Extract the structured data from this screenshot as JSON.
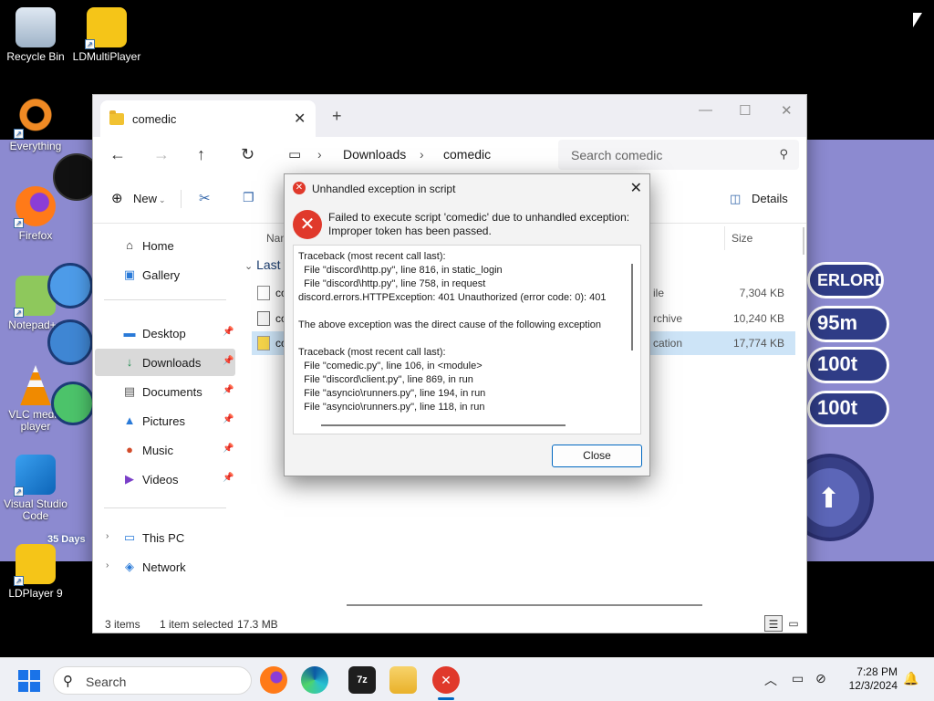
{
  "desktop": {
    "icons": [
      {
        "label": "Recycle Bin"
      },
      {
        "label": "LDMultiPlayer"
      },
      {
        "label": "Everything"
      },
      {
        "label": "Firefox"
      },
      {
        "label": "Notepad++"
      },
      {
        "label": "VLC media player"
      },
      {
        "label": "Visual Studio Code"
      },
      {
        "label": "LDPlayer 9"
      }
    ],
    "game": {
      "overlord_text": "ERLORD",
      "pill2_text": "95m",
      "pill3_text": "100t",
      "pill4_text": "100t",
      "days_badge": "35 Days"
    }
  },
  "explorer": {
    "tab_title": "comedic",
    "breadcrumb": [
      "Downloads",
      "comedic"
    ],
    "search_placeholder": "Search comedic",
    "toolbar": {
      "new_label": "New",
      "details_label": "Details"
    },
    "sidebar": {
      "home": "Home",
      "gallery": "Gallery",
      "desktop": "Desktop",
      "downloads": "Downloads",
      "documents": "Documents",
      "pictures": "Pictures",
      "music": "Music",
      "videos": "Videos",
      "this_pc": "This PC",
      "network": "Network"
    },
    "columns": {
      "name": "Nam",
      "size": "Size"
    },
    "group_label": "Last",
    "files": [
      {
        "name": "co",
        "type": "ile",
        "size": "7,304 KB"
      },
      {
        "name": "co",
        "type": "rchive",
        "size": "10,240 KB"
      },
      {
        "name": "co",
        "type": "cation",
        "size": "17,774 KB"
      }
    ],
    "status": {
      "items": "3 items",
      "selected": "1 item selected",
      "size": "17.3 MB"
    }
  },
  "dialog": {
    "title": "Unhandled exception in script",
    "message_line1": "Failed to execute script 'comedic' due to unhandled exception:",
    "message_line2": "Improper token has been passed.",
    "traceback": "Traceback (most recent call last):\n  File \"discord\\http.py\", line 816, in static_login\n  File \"discord\\http.py\", line 758, in request\ndiscord.errors.HTTPException: 401 Unauthorized (error code: 0): 401\n\nThe above exception was the direct cause of the following exception\n\nTraceback (most recent call last):\n  File \"comedic.py\", line 106, in <module>\n  File \"discord\\client.py\", line 869, in run\n  File \"asyncio\\runners.py\", line 194, in run\n  File \"asyncio\\runners.py\", line 118, in run",
    "close_button": "Close"
  },
  "taskbar": {
    "search_placeholder": "Search",
    "time": "7:28 PM",
    "date": "12/3/2024"
  }
}
